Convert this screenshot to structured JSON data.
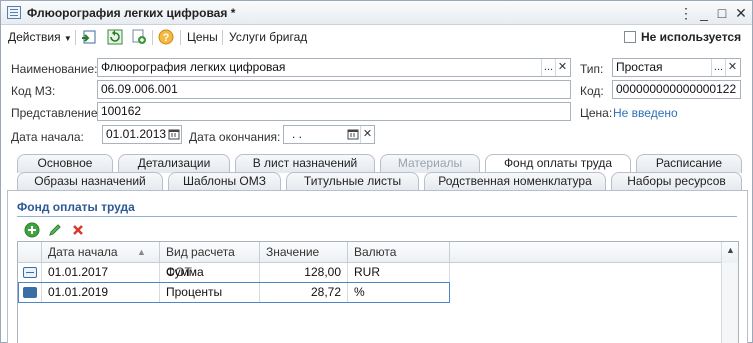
{
  "window": {
    "title": "Флюорография легких цифровая *",
    "controls": {
      "menu": "⋮",
      "minimize": "_",
      "maximize": "□",
      "close": "✕"
    }
  },
  "toolbar": {
    "actions_label": "Действия",
    "prices_label": "Цены",
    "brigade_services_label": "Услуги бригад",
    "not_used_label": "Не используется",
    "not_used_checked": false
  },
  "form": {
    "name_label": "Наименование:",
    "name_value": "Флюорография легких цифровая",
    "type_label": "Тип:",
    "type_value": "Простая",
    "mz_code_label": "Код МЗ:",
    "mz_code_value": "06.09.006.001",
    "code_label": "Код:",
    "code_value": "000000000000000122",
    "presentation_label": "Представление:",
    "presentation_value": "100162",
    "price_label": "Цена:",
    "price_link": "Не введено",
    "start_date_label": "Дата начала:",
    "start_date_value": "01.01.2013",
    "end_date_label": "Дата окончания:",
    "end_date_value": ". .",
    "ellipsis": "...",
    "clear": "✕"
  },
  "tabs": {
    "row1": [
      {
        "label": "Основное",
        "disabled": false
      },
      {
        "label": "Детализации",
        "disabled": false
      },
      {
        "label": "В лист назначений",
        "disabled": false
      },
      {
        "label": "Материалы",
        "disabled": true
      },
      {
        "label": "Фонд оплаты труда",
        "active": true
      },
      {
        "label": "Расписание",
        "disabled": false
      }
    ],
    "row2": [
      {
        "label": "Образы назначений"
      },
      {
        "label": "Шаблоны ОМЗ"
      },
      {
        "label": "Титульные листы"
      },
      {
        "label": "Родственная номенклатура"
      },
      {
        "label": "Наборы ресурсов"
      }
    ]
  },
  "payroll": {
    "section_title": "Фонд оплаты труда",
    "columns": [
      "Дата начала",
      "Вид расчета ФОТ",
      "Значение",
      "Валюта"
    ],
    "rows": [
      {
        "date": "01.01.2017",
        "calc_type": "Сумма",
        "value": "128,00",
        "currency": "RUR"
      },
      {
        "date": "01.01.2019",
        "calc_type": "Проценты",
        "value": "28,72",
        "currency": "%"
      }
    ]
  },
  "colors": {
    "accent": "#2d5a96",
    "link": "#2d6fb8",
    "selection": "#4d86c8"
  }
}
